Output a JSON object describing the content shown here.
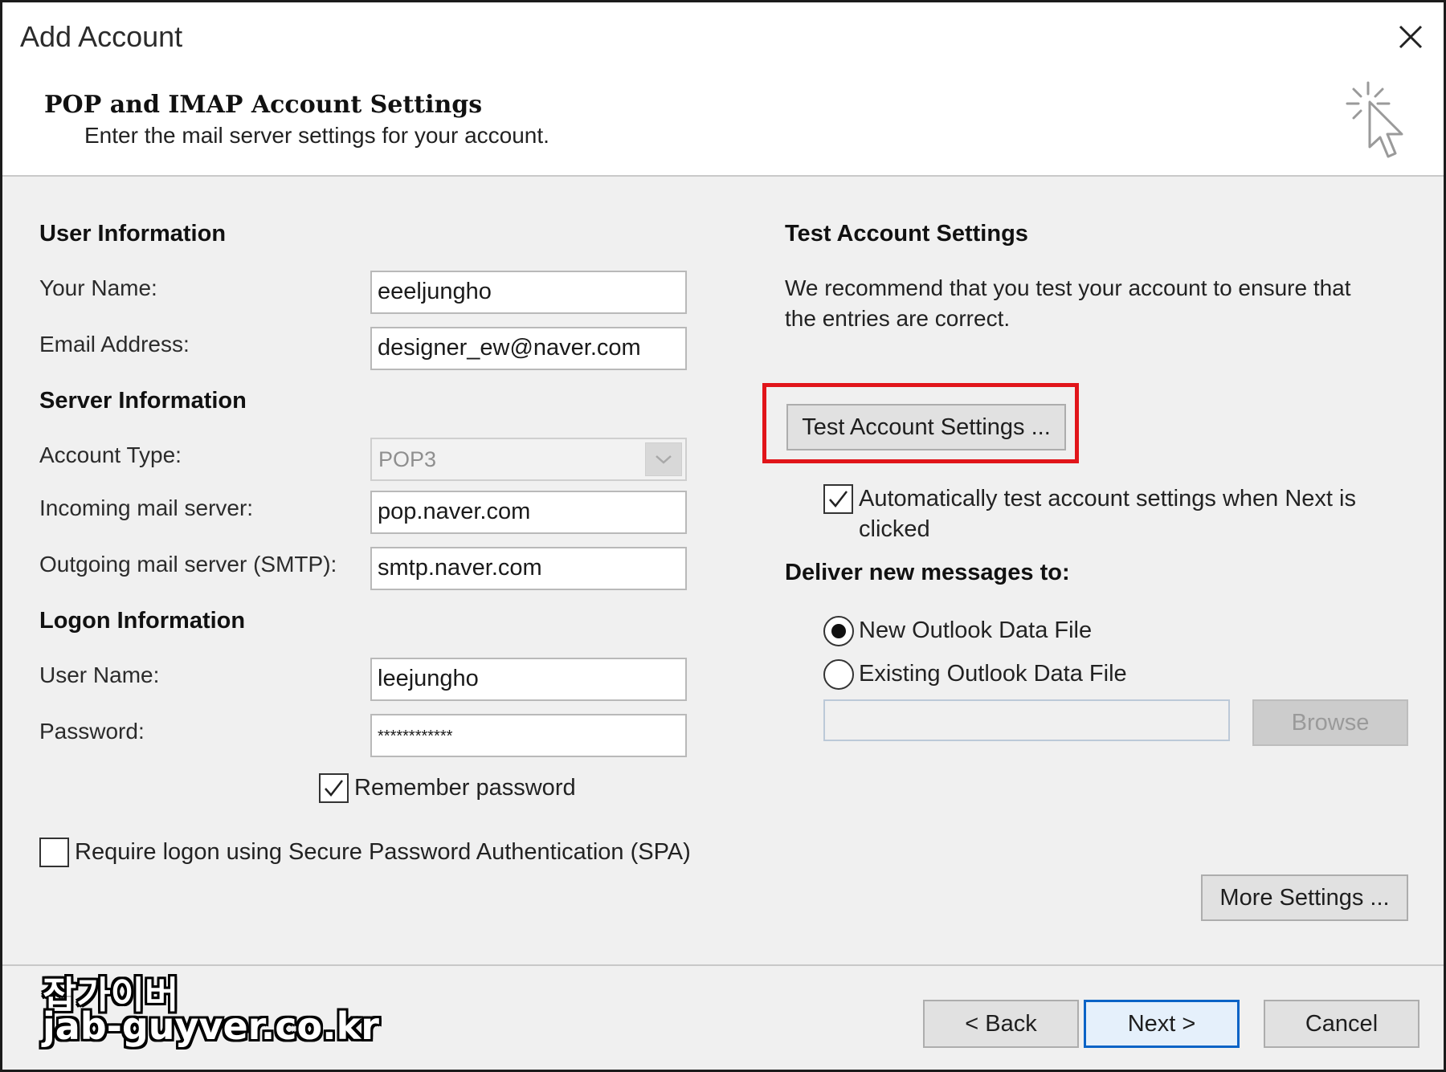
{
  "window": {
    "title": "Add Account"
  },
  "header": {
    "title": "POP and IMAP Account Settings",
    "subtitle": "Enter the mail server settings for your account."
  },
  "user_info": {
    "section_title": "User Information",
    "your_name_label": "Your Name:",
    "your_name_value": "eeeljungho",
    "email_label": "Email Address:",
    "email_value": "designer_ew@naver.com"
  },
  "server_info": {
    "section_title": "Server Information",
    "account_type_label": "Account Type:",
    "account_type_value": "POP3",
    "incoming_label": "Incoming mail server:",
    "incoming_value": "pop.naver.com",
    "outgoing_label": "Outgoing mail server (SMTP):",
    "outgoing_value": "smtp.naver.com"
  },
  "logon_info": {
    "section_title": "Logon Information",
    "username_label": "User Name:",
    "username_value": "leejungho",
    "password_label": "Password:",
    "password_value": "************",
    "remember_label": "Remember password",
    "remember_checked": true,
    "spa_label": "Require logon using Secure Password Authentication (SPA)",
    "spa_checked": false
  },
  "test_settings": {
    "section_title": "Test Account Settings",
    "description_line1": "We recommend that you test your account to ensure that",
    "description_line2": "the entries are correct.",
    "test_button_label": "Test Account Settings ...",
    "auto_test_line1": "Automatically test account settings when Next is",
    "auto_test_line2": "clicked",
    "auto_test_checked": true
  },
  "deliver": {
    "section_title": "Deliver new messages to:",
    "option_new": "New Outlook Data File",
    "option_existing": "Existing Outlook Data File",
    "selected": "New Outlook Data File",
    "path_value": "",
    "browse_label": "Browse"
  },
  "buttons": {
    "more_settings": "More Settings ...",
    "back": "< Back",
    "next": "Next >",
    "cancel": "Cancel"
  },
  "watermark": {
    "line1": "잡가이버",
    "line2": "jab-guyver.co.kr"
  },
  "colors": {
    "highlight": "#e1151a",
    "primary_border": "#0a63c6",
    "dialog_bg": "#f0f0f0"
  }
}
